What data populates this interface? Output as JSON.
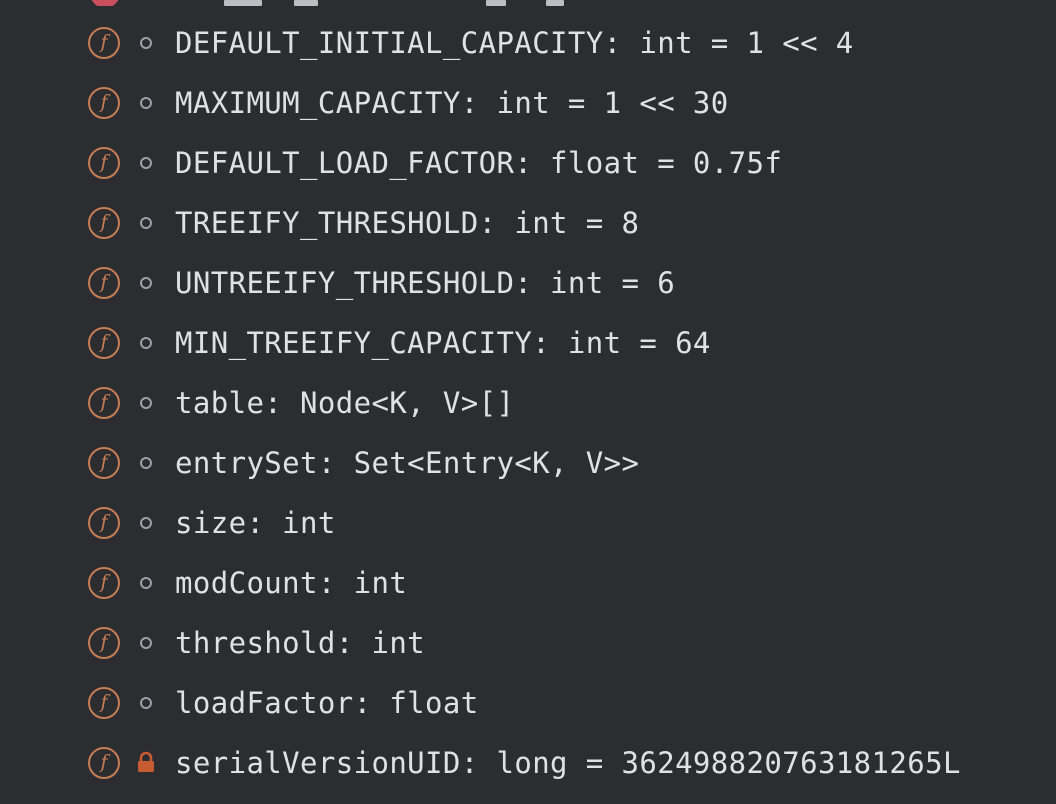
{
  "fields": [
    {
      "text": "DEFAULT_INITIAL_CAPACITY: int = 1 << 4",
      "visibility": "package-private"
    },
    {
      "text": "MAXIMUM_CAPACITY: int = 1 << 30",
      "visibility": "package-private"
    },
    {
      "text": "DEFAULT_LOAD_FACTOR: float = 0.75f",
      "visibility": "package-private"
    },
    {
      "text": "TREEIFY_THRESHOLD: int = 8",
      "visibility": "package-private"
    },
    {
      "text": "UNTREEIFY_THRESHOLD: int = 6",
      "visibility": "package-private"
    },
    {
      "text": "MIN_TREEIFY_CAPACITY: int = 64",
      "visibility": "package-private"
    },
    {
      "text": "table: Node<K, V>[]",
      "visibility": "package-private"
    },
    {
      "text": "entrySet: Set<Entry<K, V>>",
      "visibility": "package-private"
    },
    {
      "text": "size: int",
      "visibility": "package-private"
    },
    {
      "text": "modCount: int",
      "visibility": "package-private"
    },
    {
      "text": "threshold: int",
      "visibility": "package-private"
    },
    {
      "text": "loadFactor: float",
      "visibility": "package-private"
    },
    {
      "text": "serialVersionUID: long = 362498820763181265L",
      "visibility": "private"
    }
  ],
  "icons": {
    "field_glyph": "f",
    "field_icon": "field-icon",
    "package_private_icon": "package-private-dot-icon",
    "private_icon": "lock-icon"
  },
  "colors": {
    "background": "#2b2d30",
    "field_icon": "#c77d55",
    "text": "#dfe1e5",
    "package_private_dot": "#9da0a8",
    "lock": "#c75b32"
  }
}
